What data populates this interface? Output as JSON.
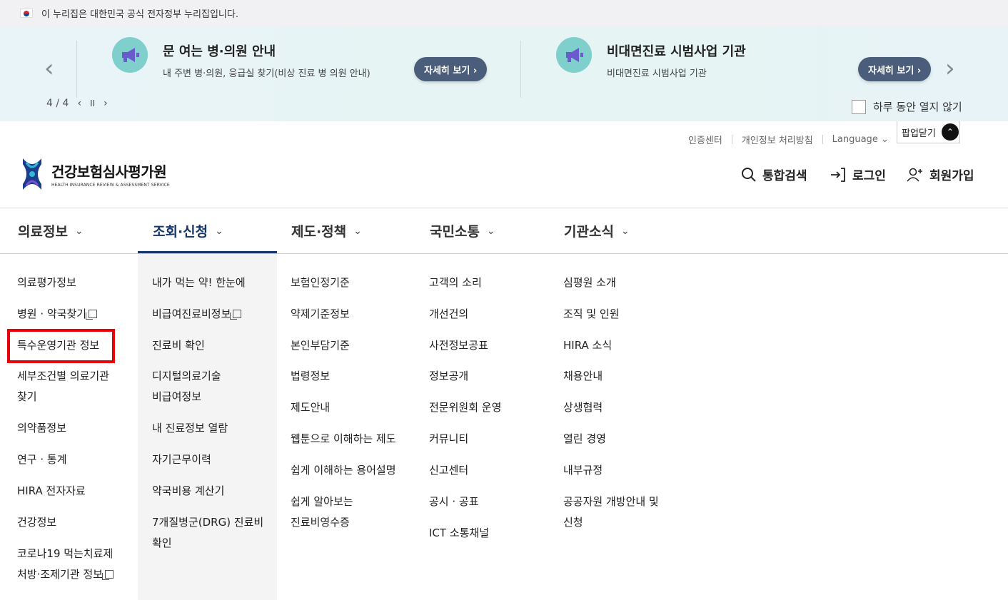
{
  "gov_banner": {
    "text": "이 누리집은 대한민국 공식 전자정부 누리집입니다."
  },
  "popup": {
    "prev_glyph": "‹",
    "next_glyph": "›",
    "pager": {
      "current_total": "4 / 4",
      "prev": "‹",
      "pause": "II",
      "next": "›"
    },
    "notices": [
      {
        "title": "문 여는 병·의원 안내",
        "desc": "내 주변 병·의원, 응급실 찾기(비상 진료 병 의원 안내)",
        "button": "자세히 보기 ›"
      },
      {
        "title": "비대면진료 시범사업 기관",
        "desc": "비대면진료 시범사업 기관",
        "button": "자세히 보기 ›"
      }
    ],
    "hide_today_label": "하루 동안 열지 않기",
    "close_label": "팝업닫기",
    "close_glyph": "⌃"
  },
  "utility": {
    "cert": "인증센터",
    "privacy": "개인정보 처리방침",
    "language": "Language ⌄"
  },
  "logo": {
    "name": "건강보험심사평가원",
    "sub": "HEALTH INSURANCE REVIEW & ASSESSMENT SERVICE"
  },
  "header_actions": {
    "search": "통합검색",
    "login": "로그인",
    "signup": "회원가입"
  },
  "gnb": [
    {
      "label": "의료정보",
      "chev": "⌄"
    },
    {
      "label": "조회·신청",
      "chev": "⌄"
    },
    {
      "label": "제도·정책",
      "chev": "⌄"
    },
    {
      "label": "국민소통",
      "chev": "⌄"
    },
    {
      "label": "기관소식",
      "chev": "⌄"
    }
  ],
  "menu": {
    "col1": [
      "의료평가정보",
      "병원 · 약국찾기",
      "특수운영기관 정보",
      "세부조건별 의료기관",
      "찾기",
      "의약품정보",
      "연구 · 통계",
      "HIRA 전자자료",
      "건강정보",
      "코로나19 먹는치료제",
      "처방·조제기관 정보"
    ],
    "col2": [
      "내가 먹는 약! 한눈에",
      "비급여진료비정보",
      "진료비 확인",
      "디지털의료기술",
      "비급여정보",
      "내 진료정보 열람",
      "자기근무이력",
      "약국비용 계산기",
      "7개질병군(DRG) 진료비",
      "확인"
    ],
    "col3": [
      "보험인정기준",
      "약제기준정보",
      "본인부담기준",
      "법령정보",
      "제도안내",
      "웹툰으로 이해하는 제도",
      "쉽게 이해하는 용어설명",
      "쉽게 알아보는",
      "진료비영수증"
    ],
    "col4": [
      "고객의 소리",
      "개선건의",
      "사전정보공표",
      "정보공개",
      "전문위원회 운영",
      "커뮤니티",
      "신고센터",
      "공시 · 공표",
      "ICT 소통채널"
    ],
    "col5": [
      "심평원 소개",
      "조직 및 인원",
      "HIRA 소식",
      "채용안내",
      "상생협력",
      "열린 경영",
      "내부규정",
      "공공자원 개방안내 및",
      "신청"
    ]
  },
  "colors": {
    "brand_navy": "#16366b",
    "highlight_red": "#e8000b",
    "button_slate": "#4a5d7a"
  }
}
